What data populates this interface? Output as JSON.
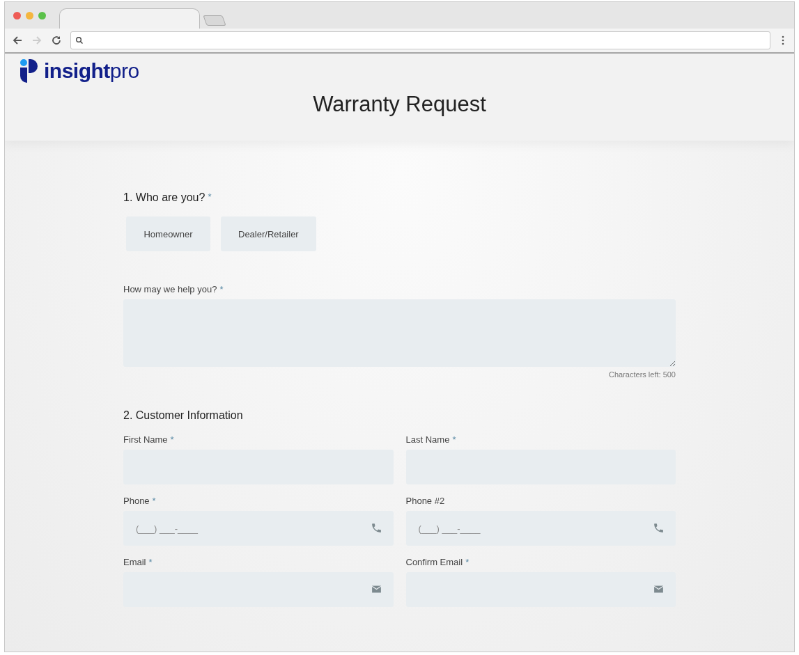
{
  "logo": {
    "text": "**insight**pro"
  },
  "title": "Warranty Request",
  "section_1": {
    "heading": "1. Who are you?",
    "mark": "*",
    "options": [
      {
        "label": "Homeowner",
        "selected": false
      },
      {
        "label": "Dealer/Retailer",
        "selected": false
      }
    ],
    "help": {
      "label": "How may we help you?",
      "mark": "*",
      "counter": "Characters left: 500"
    }
  },
  "section_2": {
    "heading": "2. Customer Information",
    "fields": [
      {
        "label": "First Name",
        "mark": "*",
        "kind": "text"
      },
      {
        "label": "Last Name",
        "mark": "*",
        "kind": "text"
      },
      {
        "label": "Phone",
        "mark": "*",
        "kind": "phone",
        "placeholder": "(___) ___-____"
      },
      {
        "label": "Phone #2",
        "kind": "phone",
        "placeholder": "(___) ___-____"
      },
      {
        "label": "Email",
        "mark": "*",
        "kind": "email"
      },
      {
        "label": "Confirm Email",
        "mark": "*",
        "kind": "email"
      }
    ]
  }
}
